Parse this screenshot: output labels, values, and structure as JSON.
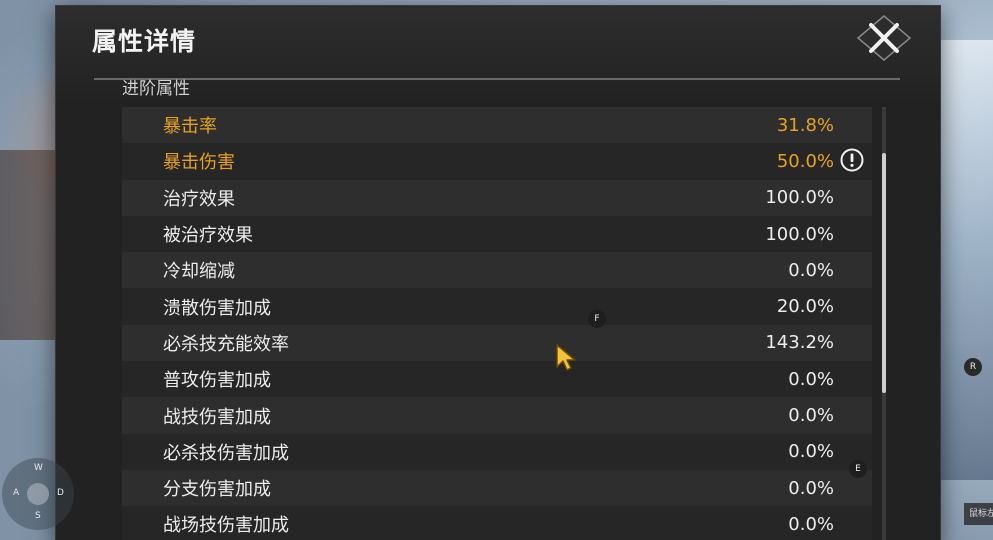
{
  "panel": {
    "title": "属性详情",
    "section_title": "进阶属性"
  },
  "stats": [
    {
      "label": "暴击率",
      "value": "31.8%"
    },
    {
      "label": "暴击伤害",
      "value": "50.0%"
    },
    {
      "label": "治疗效果",
      "value": "100.0%"
    },
    {
      "label": "被治疗效果",
      "value": "100.0%"
    },
    {
      "label": "冷却缩减",
      "value": "0.0%"
    },
    {
      "label": "溃散伤害加成",
      "value": "20.0%"
    },
    {
      "label": "必杀技充能效率",
      "value": "143.2%"
    },
    {
      "label": "普攻伤害加成",
      "value": "0.0%"
    },
    {
      "label": "战技伤害加成",
      "value": "0.0%"
    },
    {
      "label": "必杀技伤害加成",
      "value": "0.0%"
    },
    {
      "label": "分支伤害加成",
      "value": "0.0%"
    },
    {
      "label": "战场技伤害加成",
      "value": "0.0%"
    }
  ],
  "hotkeys": {
    "f": "F",
    "r": "R",
    "e": "E"
  },
  "wasd": {
    "w": "W",
    "a": "A",
    "s": "S",
    "d": "D"
  },
  "mouse_hint": "鼠标左",
  "icons": {
    "close": "close-x-icon",
    "info": "exclamation-circle-icon",
    "cursor": "arrow-cursor-icon"
  },
  "colors": {
    "highlight": "#e9a220",
    "panel_bg": "#222222",
    "text": "#ececec"
  },
  "scroll_position": 0.23
}
